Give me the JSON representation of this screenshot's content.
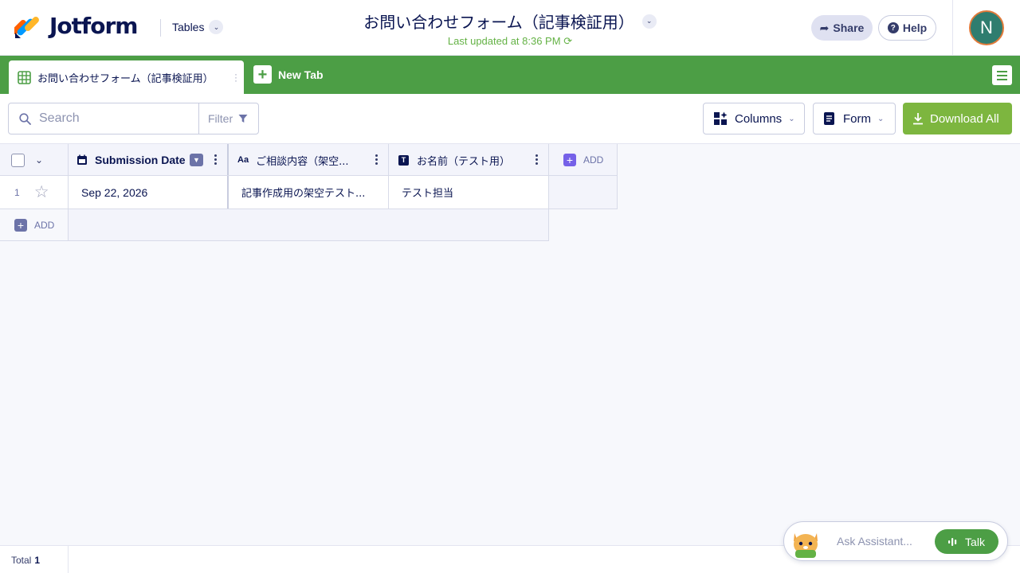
{
  "brand": {
    "name": "Jotform"
  },
  "header": {
    "tables_label": "Tables",
    "title": "お問い合わせフォーム（記事検証用）",
    "last_updated": "Last updated at 8:36 PM",
    "share_label": "Share",
    "help_label": "Help",
    "avatar_initial": "N"
  },
  "tabs": {
    "active_label": "お問い合わせフォーム（記事検証用）",
    "new_tab_label": "New Tab"
  },
  "toolbar": {
    "search_placeholder": "Search",
    "filter_label": "Filter",
    "columns_label": "Columns",
    "form_label": "Form",
    "download_label": "Download All"
  },
  "table": {
    "columns": [
      {
        "label": "Submission Date",
        "icon": "calendar-icon",
        "pinned": true
      },
      {
        "label": "ご相談内容（架空...",
        "icon": "text-aa-icon"
      },
      {
        "label": "お名前（テスト用）",
        "icon": "text-t-icon"
      }
    ],
    "add_column_label": "ADD",
    "rows": [
      {
        "num": "1",
        "starred": false,
        "cells": [
          "Sep 22, 2026",
          "記事作成用の架空テスト...",
          "テスト担当"
        ]
      }
    ],
    "add_row_label": "ADD"
  },
  "footer": {
    "total_label": "Total",
    "total_count": "1"
  },
  "assistant": {
    "placeholder": "Ask Assistant...",
    "talk_label": "Talk"
  },
  "colors": {
    "brand_green": "#4c9e45",
    "download_green": "#7db63f",
    "navy": "#0a1551",
    "purple": "#7561e8"
  }
}
